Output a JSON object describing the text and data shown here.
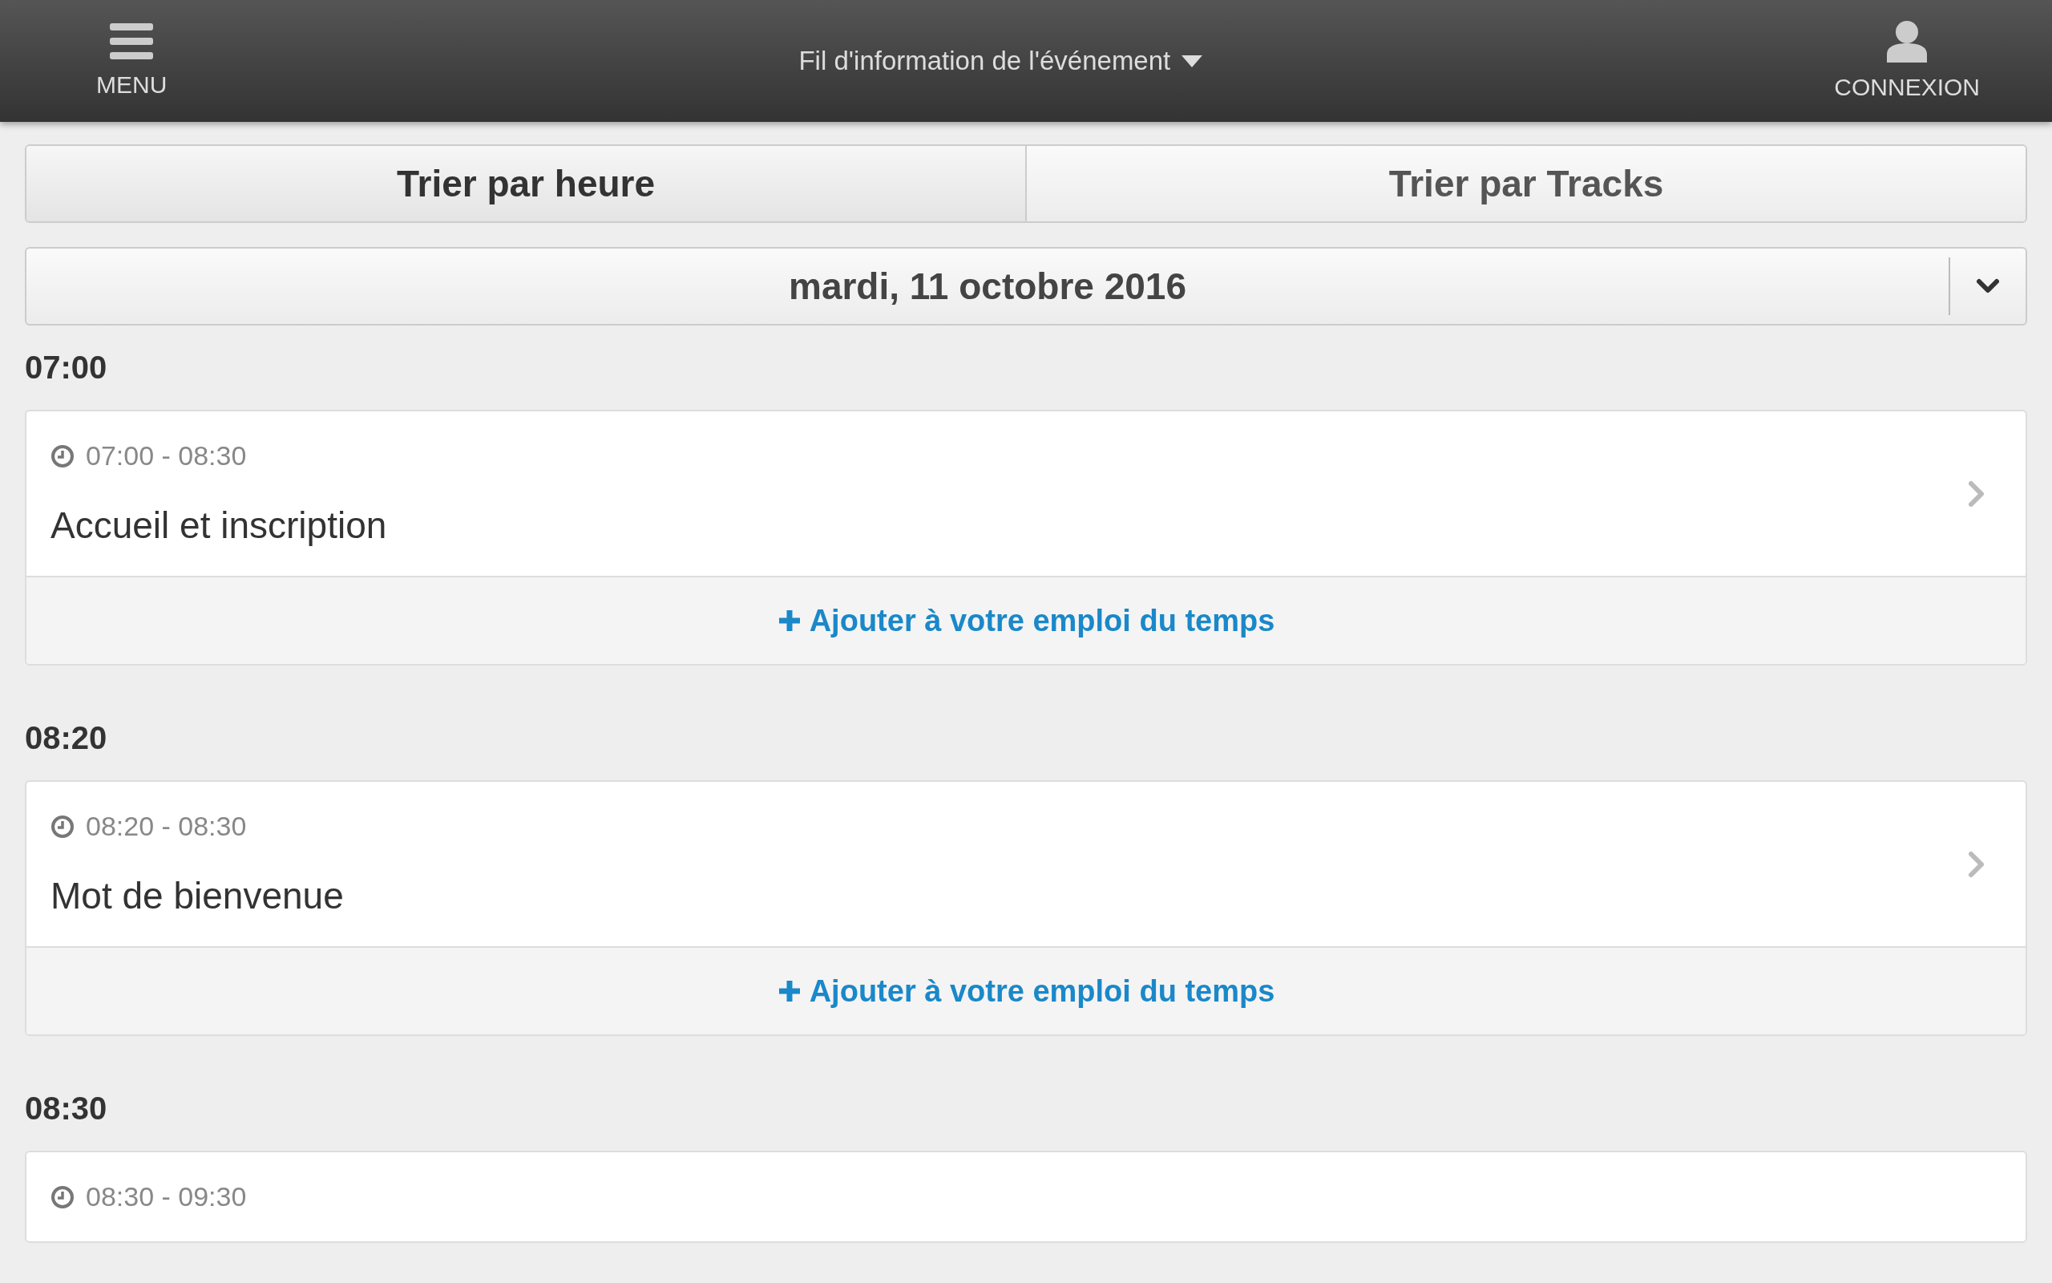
{
  "header": {
    "menu_label": "MENU",
    "title": "Fil d'information de l'événement",
    "login_label": "CONNEXION"
  },
  "tabs": [
    {
      "label": "Trier par heure",
      "selected": true
    },
    {
      "label": "Trier par Tracks",
      "selected": false
    }
  ],
  "date_select": {
    "value": "mardi, 11 octobre 2016"
  },
  "groups": [
    {
      "time": "07:00",
      "sessions": [
        {
          "range": "07:00 - 08:30",
          "title": "Accueil et inscription",
          "action": "Ajouter à votre emploi du temps"
        }
      ]
    },
    {
      "time": "08:20",
      "sessions": [
        {
          "range": "08:20 - 08:30",
          "title": "Mot de bienvenue",
          "action": "Ajouter à votre emploi du temps"
        }
      ]
    },
    {
      "time": "08:30",
      "sessions": [
        {
          "range": "08:30 - 09:30"
        }
      ]
    }
  ]
}
